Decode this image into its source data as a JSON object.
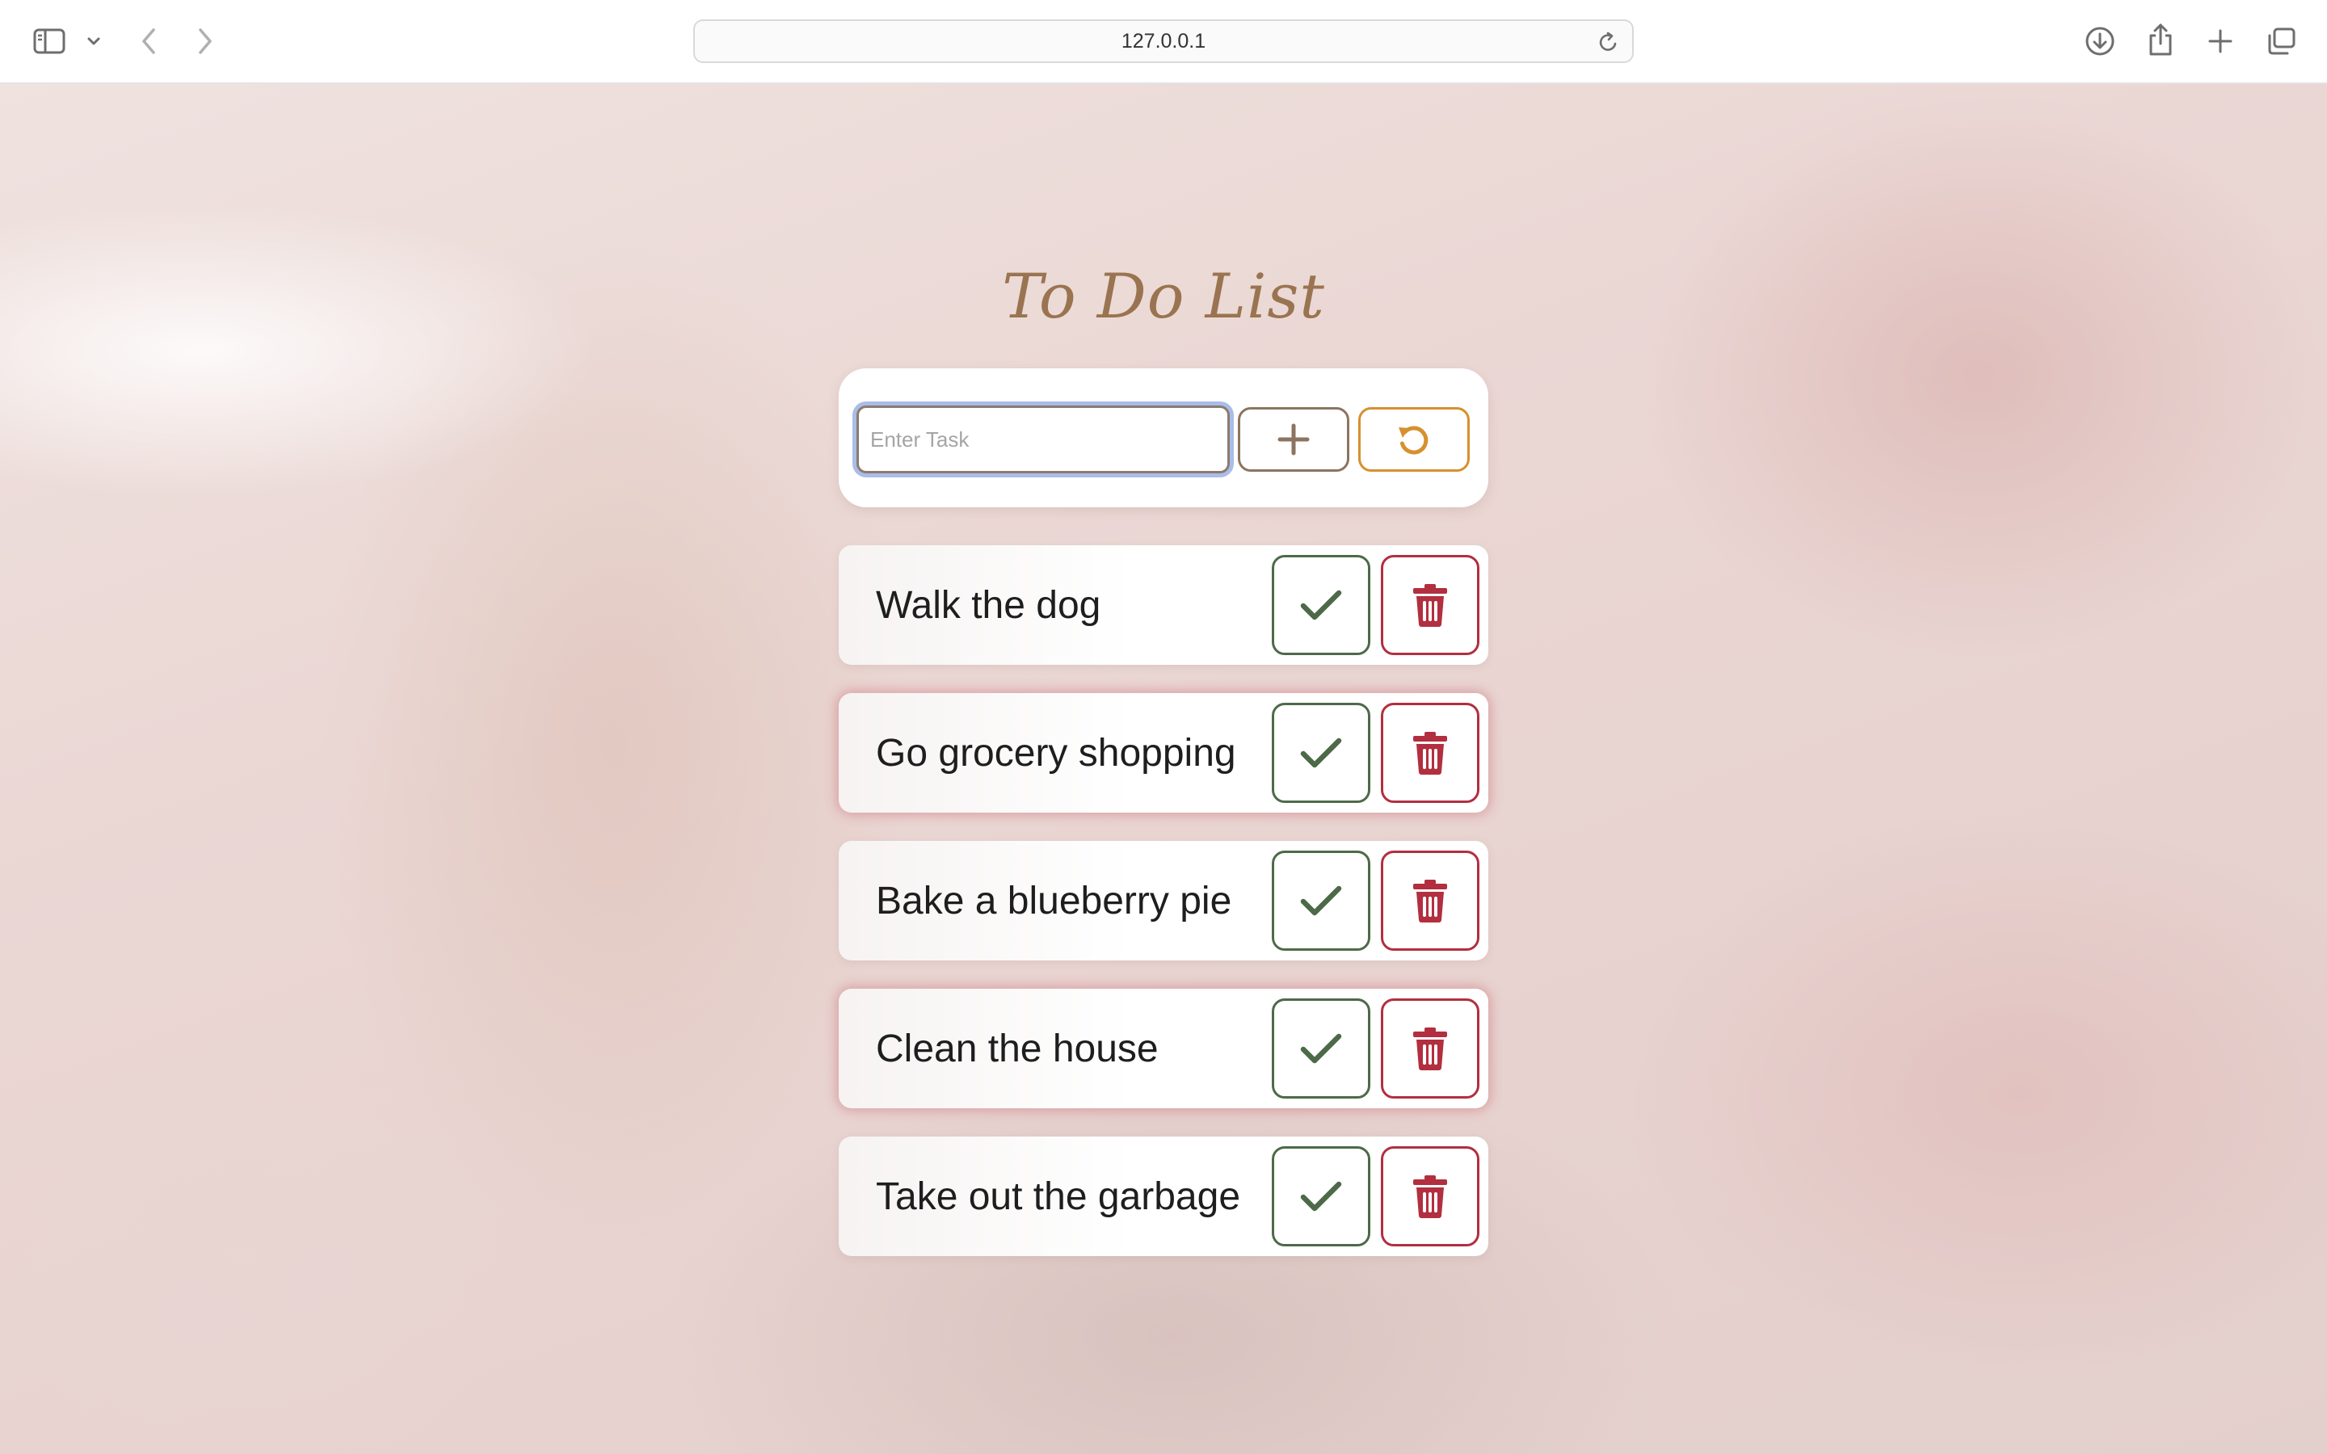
{
  "browser": {
    "url": "127.0.0.1"
  },
  "app": {
    "title": "To Do List",
    "input": {
      "value": "",
      "placeholder": "Enter Task"
    },
    "buttons": {
      "add_icon": "plus-icon",
      "reset_icon": "refresh-icon"
    },
    "tasks": [
      {
        "text": "Walk the dog",
        "highlighted": false
      },
      {
        "text": "Go grocery shopping",
        "highlighted": true
      },
      {
        "text": "Bake a blueberry pie",
        "highlighted": false
      },
      {
        "text": "Clean the house",
        "highlighted": true
      },
      {
        "text": "Take out the garbage",
        "highlighted": false
      }
    ],
    "task_action_icons": {
      "complete": "check-icon",
      "delete": "trash-icon"
    }
  },
  "colors": {
    "title": "#9a7450",
    "add_border": "#8d7460",
    "reset_border": "#d6902f",
    "check_green": "#4d6a48",
    "delete_red": "#b22f3f",
    "focus_ring": "#a9bde8"
  }
}
